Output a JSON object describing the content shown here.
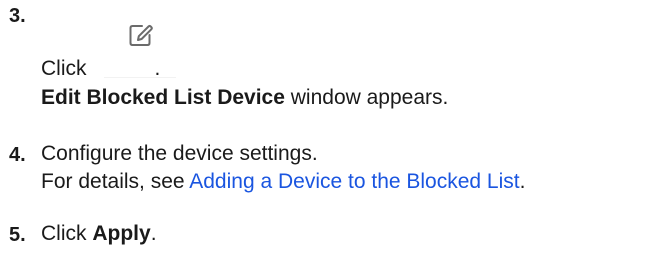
{
  "steps": [
    {
      "number": "3.",
      "click_prefix": "Click",
      "click_suffix": ".",
      "icon": "edit-icon",
      "result_bold": "Edit Blocked List Device",
      "result_rest": " window appears."
    },
    {
      "number": "4.",
      "line1": "Configure the device settings.",
      "details_prefix": "For details, see ",
      "link_text": "Adding a Device to the Blocked List",
      "details_suffix": "."
    },
    {
      "number": "5.",
      "prefix": "Click ",
      "bold": "Apply",
      "suffix": "."
    }
  ],
  "colors": {
    "text": "#1a1a1a",
    "link": "#1a55e0",
    "icon": "#6b6b6b"
  }
}
